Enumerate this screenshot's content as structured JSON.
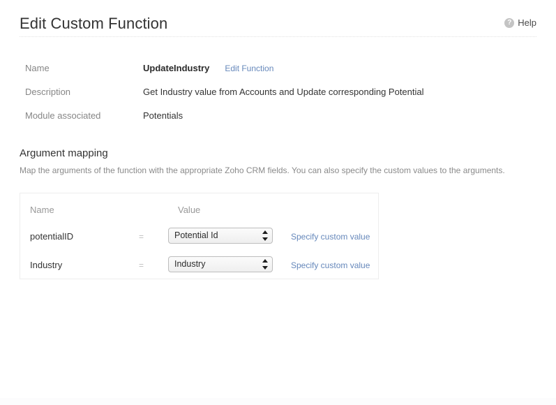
{
  "header": {
    "title": "Edit Custom Function",
    "help_label": "Help",
    "help_icon": "question-mark-circle-icon"
  },
  "details": {
    "rows": [
      {
        "label": "Name",
        "value": "UpdateIndustry",
        "link": "Edit Function"
      },
      {
        "label": "Description",
        "value": "Get Industry value from Accounts and Update corresponding Potential"
      },
      {
        "label": "Module associated",
        "value": "Potentials"
      }
    ]
  },
  "argument_mapping": {
    "title": "Argument mapping",
    "description": "Map the arguments of the function with the appropriate Zoho CRM fields. You can also specify the custom values to the arguments.",
    "columns": {
      "name": "Name",
      "value": "Value"
    },
    "equals_symbol": "=",
    "rows": [
      {
        "name": "potentialID",
        "selected_value": "Potential Id",
        "custom_link": "Specify custom value"
      },
      {
        "name": "Industry",
        "selected_value": "Industry",
        "custom_link": "Specify custom value"
      }
    ]
  },
  "colors": {
    "link": "#6688bb",
    "muted_text": "#868686",
    "body_text": "#333333",
    "panel_border": "#ededed",
    "help_icon_bg": "#c4c4c4"
  }
}
